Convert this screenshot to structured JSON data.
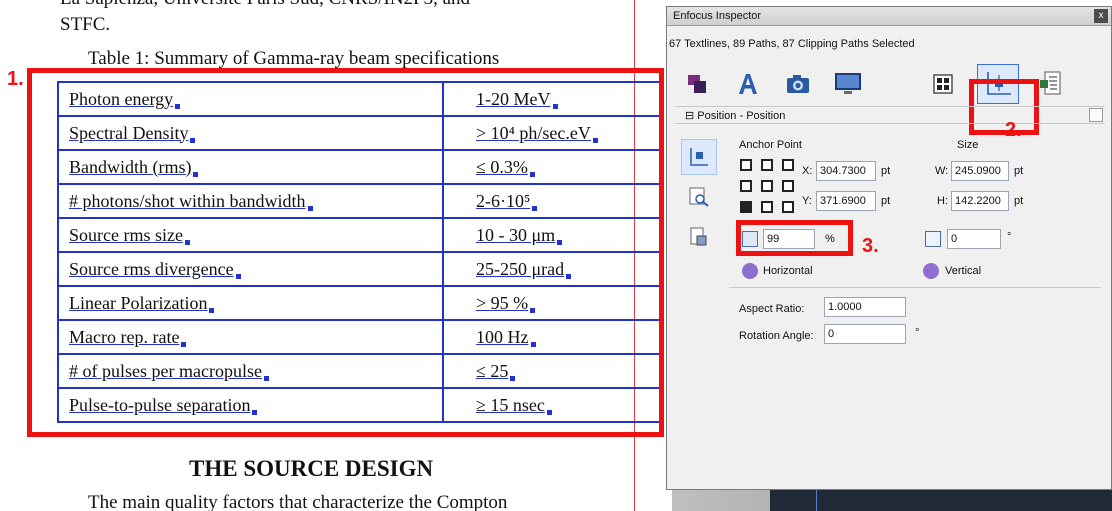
{
  "document": {
    "top_line": "La Sapienza, Université Paris Sud, CNRS/IN2P3, and",
    "top_line2": "STFC.",
    "caption": "Table 1: Summary of Gamma-ray beam specifications",
    "annotation_1": "1.",
    "rows": [
      {
        "param": "Photon energy",
        "value": "1-20 MeV"
      },
      {
        "param": "Spectral Density",
        "value": "> 10⁴ ph/sec.eV"
      },
      {
        "param": "Bandwidth (rms)",
        "value": "≤ 0.3%"
      },
      {
        "param": "# photons/shot within bandwidth",
        "value": "2-6·10⁵"
      },
      {
        "param": "Source rms size",
        "value": "10 - 30 μm"
      },
      {
        "param": "Source rms divergence",
        "value": "25-250 μrad"
      },
      {
        "param": "Linear Polarization",
        "value": "> 95 %"
      },
      {
        "param": "Macro rep. rate",
        "value": "100 Hz"
      },
      {
        "param": "# of pulses per macropulse",
        "value": "≤ 25"
      },
      {
        "param": "Pulse-to-pulse separation",
        "value": "≥ 15 nsec"
      }
    ],
    "section_title": "THE SOURCE DESIGN",
    "bottom_line": "The main quality factors that characterize the Compton"
  },
  "inspector": {
    "title": "Enfocus Inspector",
    "close_label": "x",
    "selection_text": "67 Textlines, 89 Paths, 87 Clipping Paths Selected",
    "section_label": "Position - Position",
    "annotation_2": "2.",
    "annotation_3": "3.",
    "anchor_point_label": "Anchor Point",
    "size_label": "Size",
    "x_label": "X:",
    "x_value": "304.7300",
    "y_label": "Y:",
    "y_value": "371.6900",
    "w_label": "W:",
    "w_value": "245.0900",
    "h_label": "H:",
    "h_value": "142.2200",
    "unit": "pt",
    "scale_value": "99",
    "scale_unit": "%",
    "rotate_value": "0",
    "rotate_unit": "°",
    "horizontal_label": "Horizontal",
    "vertical_label": "Vertical",
    "aspect_label": "Aspect Ratio:",
    "aspect_value": "1.0000",
    "rotation_label": "Rotation Angle:",
    "rotation_value": "0",
    "rotation_unit": "°",
    "highlight_color": "#e11111",
    "accent_color": "#3a6fd8"
  }
}
